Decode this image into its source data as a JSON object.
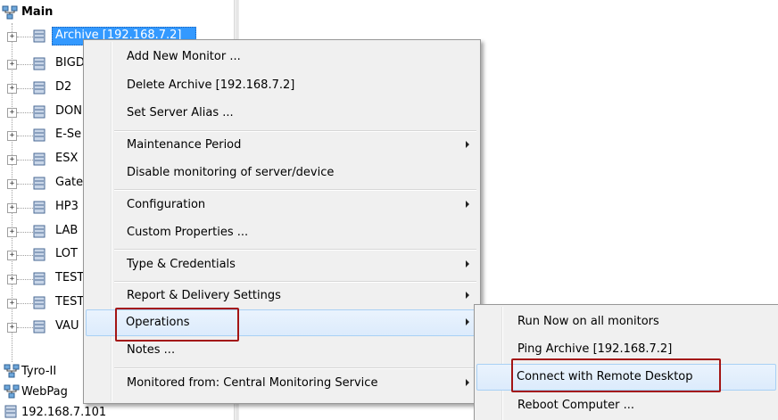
{
  "tree": {
    "root_label": "Main",
    "selected_label": "Archive [192.168.7.2]",
    "servers": [
      "BIGD",
      "D2",
      "DON",
      "E-Se",
      "ESX",
      "Gate",
      "HP3",
      "LAB",
      "LOT",
      "TEST",
      "TEST",
      "VAU"
    ],
    "groups": [
      "Tyro-II",
      "WebPag"
    ],
    "device_label": "192.168.7.101"
  },
  "context_menu": {
    "items": [
      {
        "label": "Add New Monitor ..."
      },
      {
        "label": "Delete Archive [192.168.7.2]"
      },
      {
        "label": "Set Server Alias ..."
      },
      {
        "label": "Maintenance Period",
        "submenu": true
      },
      {
        "label": "Disable monitoring of server/device"
      },
      {
        "label": "Configuration",
        "submenu": true
      },
      {
        "label": "Custom Properties ..."
      },
      {
        "label": "Type & Credentials",
        "submenu": true
      },
      {
        "label": "Report & Delivery Settings",
        "submenu": true
      },
      {
        "label": "Operations",
        "submenu": true
      },
      {
        "label": "Notes ..."
      },
      {
        "label": "Monitored from: Central Monitoring Service",
        "submenu": true
      }
    ]
  },
  "operations_submenu": {
    "items": [
      {
        "label": "Run Now on all monitors"
      },
      {
        "label": "Ping Archive [192.168.7.2]"
      },
      {
        "label": "Connect with Remote Desktop"
      },
      {
        "label": "Reboot Computer ..."
      }
    ]
  },
  "colors": {
    "selection": "#3399ff",
    "highlight_box": "#a31515",
    "menu_bg": "#f0f0f0",
    "hover_bg": "#dcebfc"
  }
}
